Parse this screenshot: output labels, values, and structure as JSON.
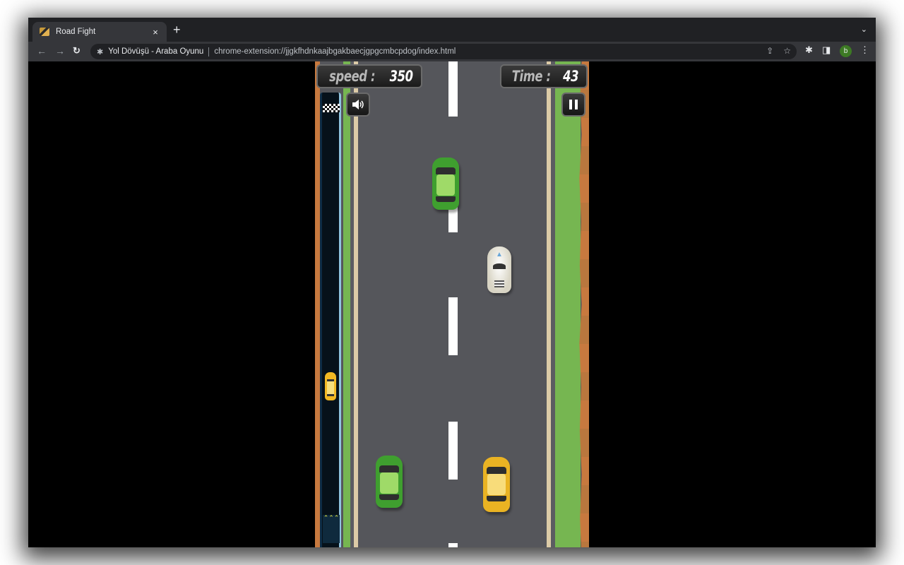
{
  "browser": {
    "tab": {
      "title": "Road Fight",
      "favicon": "road-fight-favicon"
    },
    "new_tab_label": "+",
    "tab_close_label": "×",
    "tab_menu_label": "⌄",
    "nav": {
      "back": "←",
      "forward": "→",
      "reload": "C"
    },
    "omnibox": {
      "site_icon": "extension-puzzle-icon",
      "site_name": "Yol Dövüşü - Araba Oyunu",
      "url": "chrome-extension://jjgkfhdnkaajbgakbaecjgpgcmbcpdog/index.html",
      "share_icon": "⇪",
      "bookmark_icon": "☆"
    },
    "toolbar_icons": {
      "extensions": "✱",
      "side_panel": "◨",
      "menu": "⋮"
    },
    "profile_initial": "b",
    "profile_color": "#3d7a24"
  },
  "game": {
    "hud": {
      "speed_label": "speed :",
      "speed_value": "350",
      "time_label": "Time :",
      "time_value": "43"
    },
    "buttons": {
      "sound_icon": "🔊",
      "pause_icon": "❚❚"
    },
    "minimap": {
      "finish_icon": "checkered-flag",
      "start_marker": "⌃⌃⌃",
      "progress_fraction": 0.6
    },
    "colors": {
      "road": "#55565b",
      "grass": "#76b651",
      "dirt": "#c7793f",
      "lane_line": "#dccba7",
      "green_car": "#3f9f2f",
      "yellow_car": "#eab323"
    },
    "vehicles": [
      {
        "type": "enemy",
        "color": "green",
        "lane": "center-left"
      },
      {
        "type": "player",
        "color": "white",
        "lane": "center-right"
      },
      {
        "type": "enemy",
        "color": "green",
        "lane": "left"
      },
      {
        "type": "enemy",
        "color": "yellow",
        "lane": "right"
      }
    ]
  }
}
